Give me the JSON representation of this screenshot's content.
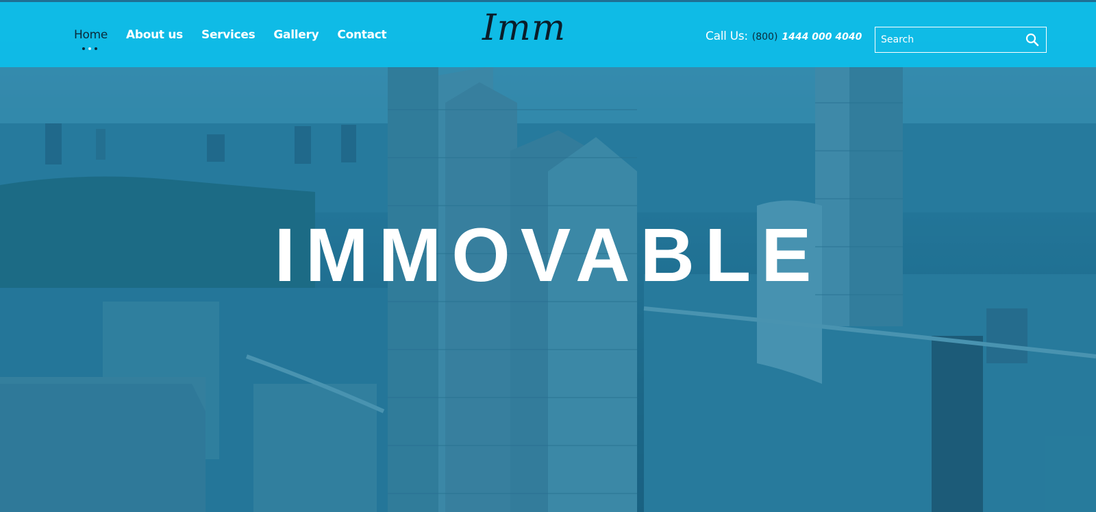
{
  "nav": {
    "items": [
      {
        "label": "Home",
        "active": true
      },
      {
        "label": "About us",
        "active": false
      },
      {
        "label": "Services",
        "active": false
      },
      {
        "label": "Gallery",
        "active": false
      },
      {
        "label": "Contact",
        "active": false
      }
    ]
  },
  "logo": {
    "text": "Imm"
  },
  "contact": {
    "label": "Call Us:",
    "area_code": "(800)",
    "number": "1444 000 4040"
  },
  "search": {
    "placeholder": "Search",
    "icon": "search-icon"
  },
  "hero": {
    "title": "IMMOVABLE"
  },
  "colors": {
    "header_bg": "#0dbeeb",
    "nav_active": "#0a2a3a",
    "hero_overlay": "#1482af"
  }
}
